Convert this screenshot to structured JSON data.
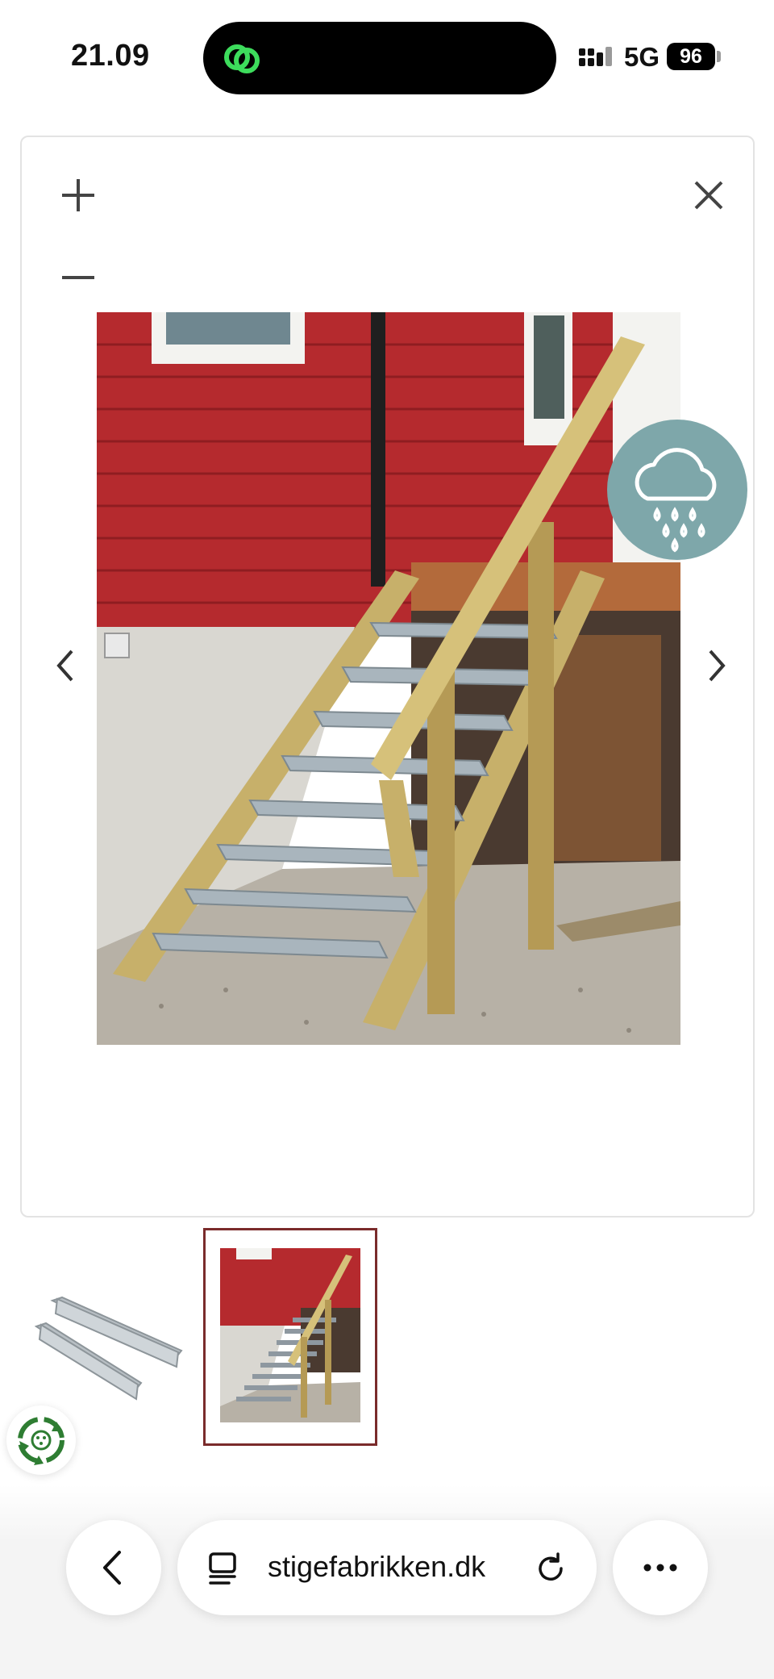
{
  "status_bar": {
    "time": "21.09",
    "network": "5G",
    "battery": "96",
    "icons": [
      "link-app-icon",
      "signal-icon",
      "battery-icon"
    ]
  },
  "viewer": {
    "controls": [
      "plus-icon",
      "minus-icon",
      "close-icon",
      "chevron-left-icon",
      "chevron-right-icon"
    ],
    "image_alt": "Wooden outdoor staircase with galvanised steel treads against a red house"
  },
  "weather_badge": {
    "icon": "rain-cloud-icon"
  },
  "thumbnails": [
    {
      "name": "stair-tread-brackets",
      "selected": false
    },
    {
      "name": "outdoor-staircase",
      "selected": true
    }
  ],
  "eco_badge": {
    "icon": "recycle-icon"
  },
  "toolbar": {
    "url": "stigefabrikken.dk",
    "icons": [
      "back-chevron-icon",
      "tabs-icon",
      "reload-icon",
      "more-icon"
    ]
  },
  "colors": {
    "house_red": "#b52a2e",
    "weather_teal": "#7ea7aa",
    "selected_border": "#7a2b2b",
    "eco_green": "#2e7d32"
  }
}
